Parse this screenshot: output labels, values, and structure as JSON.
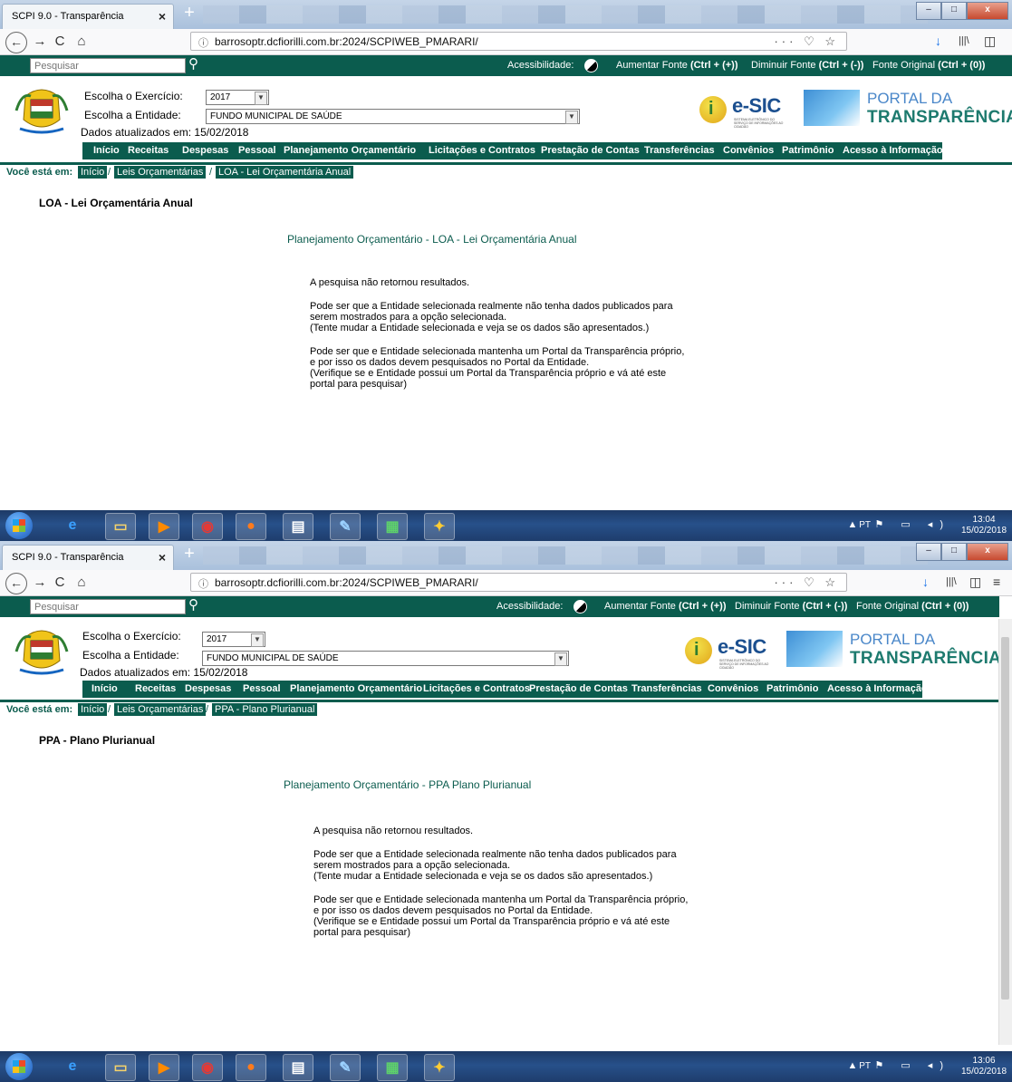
{
  "browser": {
    "tab_title": "SCPI 9.0 - Transparência",
    "tab_close": "×",
    "new_tab": "+",
    "url": "barrosoptr.dcfiorilli.com.br:2024/SCPIWEB_PMARARI/",
    "url_info": "ⓘ",
    "url_actions": "··· ♡ ☆",
    "back": "←",
    "forward": "→",
    "reload": "C",
    "home": "⌂",
    "download": "↓",
    "library": "|||\\",
    "sidebar": "◫",
    "menu": "≡",
    "win_min": "–",
    "win_max": "□",
    "win_close": "x"
  },
  "site": {
    "search_placeholder": "Pesquisar",
    "search_icon": "⚲",
    "accessibility_label": "Acessibilidade:",
    "font_increase_label": "Aumentar Fonte",
    "font_increase_shortcut": "(Ctrl + (+))",
    "font_decrease_label": "Diminuir Fonte",
    "font_decrease_shortcut": "(Ctrl + (-))",
    "font_original_label": "Fonte Original",
    "font_original_shortcut": "(Ctrl + (0))",
    "exercicio_label": "Escolha o Exercício:",
    "exercicio_value": "2017",
    "entidade_label": "Escolha a Entidade:",
    "entidade_value": "FUNDO MUNICIPAL DE SAÚDE",
    "updated": "Dados atualizados em: 15/02/2018",
    "esic_title": "e-SIC",
    "esic_sub": "SISTEMA ELETRÔNICO DO SERVIÇO DE INFORMAÇÕES AO CIDADÃO",
    "portal_line1": "PORTAL DA",
    "portal_line2": "TRANSPARÊNCIA",
    "menu": [
      "Início",
      "Receitas",
      "Despesas",
      "Pessoal",
      "Planejamento Orçamentário",
      "Licitações e Contratos",
      "Prestação de Contas",
      "Transferências",
      "Convênios",
      "Patrimônio",
      "Acesso à Informação"
    ],
    "crumb_label": "Você está em:",
    "crumb_home": "Início",
    "crumb_section": "Leis Orçamentárias",
    "crumb_sep": "/",
    "msg_p1": "A pesquisa não retornou resultados.",
    "msg_p2": "Pode ser que a Entidade selecionada realmente não tenha dados publicados para serem mostrados para a opção selecionada.\n(Tente mudar a Entidade selecionada e veja se os dados são apresentados.)",
    "msg_p3": "Pode ser que e Entidade selecionada mantenha um Portal da Transparência próprio, e por isso os dados devem pesquisados no Portal da Entidade.\n(Verifique se e Entidade possui um Portal da Transparência próprio e vá até este portal para pesquisar)"
  },
  "shot1": {
    "crumb_current": "LOA - Lei Orçamentária Anual",
    "page_title": "LOA - Lei Orçamentária Anual",
    "subtitle": "Planejamento Orçamentário - LOA - Lei Orçamentária Anual",
    "clock_time": "13:04",
    "clock_date": "15/02/2018"
  },
  "shot2": {
    "crumb_current": "PPA - Plano Plurianual",
    "page_title": "PPA - Plano Plurianual",
    "subtitle": "Planejamento Orçamentário - PPA Plano Plurianual",
    "clock_time": "13:06",
    "clock_date": "15/02/2018"
  },
  "taskbar": {
    "lang": "PT",
    "tray": "▲ ⚑ ▭ ◂)",
    "icons": [
      "internet-explorer",
      "file-explorer",
      "media-player",
      "chrome",
      "firefox",
      "word-document",
      "paint",
      "spreadsheet",
      "app"
    ]
  },
  "colors": {
    "site_green": "#0b5c4e",
    "taskbar_blue": "#27508a"
  }
}
